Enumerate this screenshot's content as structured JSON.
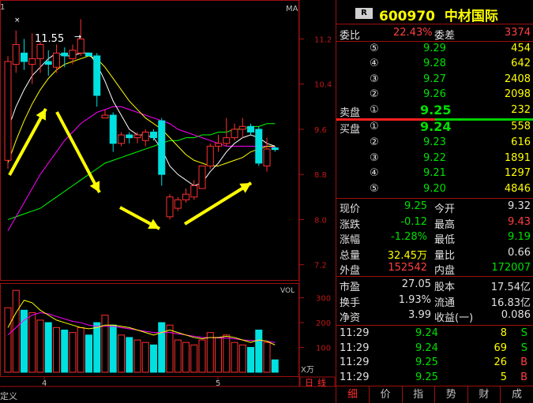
{
  "chart": {
    "top_left_label": "1",
    "ma_label": "MA",
    "high_annotation": "11.55",
    "price_axis": [
      "11.2",
      "10.4",
      "9.6",
      "8.8",
      "8.0",
      "7.2"
    ],
    "vol_label": "VOL",
    "vol_axis": [
      "300",
      "200",
      "100"
    ],
    "vol_unit": "X万",
    "x_ticks": [
      "4",
      "5"
    ],
    "tab_day": "日",
    "tab_line": "线",
    "bottom_left": "定义",
    "colors": {
      "up": "#ff3030",
      "down": "#00e0e0",
      "ma5": "#ffffff",
      "ma10": "#ffff00",
      "ma20": "#ff00ff",
      "ma60": "#00ff00",
      "arrow": "#ffff00",
      "grid": "#a01010"
    },
    "candles": [
      {
        "o": 9.05,
        "h": 10.9,
        "l": 8.9,
        "c": 10.8
      },
      {
        "o": 10.75,
        "h": 11.35,
        "l": 10.6,
        "c": 11.1
      },
      {
        "o": 10.95,
        "h": 11.2,
        "l": 10.65,
        "c": 10.8
      },
      {
        "o": 10.75,
        "h": 11.3,
        "l": 10.4,
        "c": 10.85
      },
      {
        "o": 10.85,
        "h": 11.15,
        "l": 10.6,
        "c": 11.1
      },
      {
        "o": 10.8,
        "h": 11.0,
        "l": 10.55,
        "c": 10.75
      },
      {
        "o": 10.7,
        "h": 11.1,
        "l": 10.6,
        "c": 10.95
      },
      {
        "o": 10.95,
        "h": 11.05,
        "l": 10.7,
        "c": 10.9
      },
      {
        "o": 10.85,
        "h": 11.1,
        "l": 10.75,
        "c": 11.0
      },
      {
        "o": 10.95,
        "h": 11.55,
        "l": 10.9,
        "c": 11.2
      },
      {
        "o": 10.95,
        "h": 10.95,
        "l": 10.9,
        "c": 10.9
      },
      {
        "o": 10.9,
        "h": 10.95,
        "l": 10.0,
        "c": 10.2
      },
      {
        "o": 9.8,
        "h": 9.95,
        "l": 9.8,
        "c": 9.85
      },
      {
        "o": 9.85,
        "h": 9.9,
        "l": 9.2,
        "c": 9.35
      },
      {
        "o": 9.35,
        "h": 9.55,
        "l": 9.3,
        "c": 9.5
      },
      {
        "o": 9.5,
        "h": 9.55,
        "l": 9.35,
        "c": 9.45
      },
      {
        "o": 9.45,
        "h": 9.55,
        "l": 9.35,
        "c": 9.5
      },
      {
        "o": 9.4,
        "h": 9.6,
        "l": 9.3,
        "c": 9.55
      },
      {
        "o": 9.55,
        "h": 9.6,
        "l": 9.4,
        "c": 9.45
      },
      {
        "o": 9.75,
        "h": 9.8,
        "l": 8.6,
        "c": 8.8
      },
      {
        "o": 8.05,
        "h": 8.45,
        "l": 8.0,
        "c": 8.4
      },
      {
        "o": 8.2,
        "h": 8.4,
        "l": 8.15,
        "c": 8.35
      },
      {
        "o": 8.35,
        "h": 8.55,
        "l": 8.3,
        "c": 8.45
      },
      {
        "o": 8.4,
        "h": 8.7,
        "l": 8.35,
        "c": 8.6
      },
      {
        "o": 8.55,
        "h": 8.95,
        "l": 8.55,
        "c": 8.95
      },
      {
        "o": 8.95,
        "h": 9.35,
        "l": 8.9,
        "c": 9.3
      },
      {
        "o": 9.3,
        "h": 9.5,
        "l": 9.2,
        "c": 9.35
      },
      {
        "o": 9.35,
        "h": 9.8,
        "l": 9.3,
        "c": 9.45
      },
      {
        "o": 9.45,
        "h": 9.7,
        "l": 9.4,
        "c": 9.6
      },
      {
        "o": 9.6,
        "h": 9.8,
        "l": 9.45,
        "c": 9.65
      },
      {
        "o": 9.65,
        "h": 9.7,
        "l": 9.5,
        "c": 9.55
      },
      {
        "o": 9.6,
        "h": 9.65,
        "l": 8.95,
        "c": 9.0
      },
      {
        "o": 8.95,
        "h": 9.45,
        "l": 8.85,
        "c": 9.25
      },
      {
        "o": 9.27,
        "h": 9.3,
        "l": 9.2,
        "c": 9.24
      }
    ],
    "ma5": [
      9.6,
      10.0,
      10.3,
      10.55,
      10.7,
      10.85,
      10.95,
      10.9,
      10.9,
      10.95,
      10.95,
      10.75,
      10.45,
      10.1,
      9.85,
      9.6,
      9.5,
      9.5,
      9.45,
      9.25,
      8.95,
      8.8,
      8.7,
      8.6,
      8.65,
      8.85,
      9.0,
      9.2,
      9.35,
      9.45,
      9.5,
      9.45,
      9.35,
      9.3
    ],
    "ma10": [
      9.0,
      9.4,
      9.75,
      10.05,
      10.3,
      10.5,
      10.65,
      10.75,
      10.8,
      10.85,
      10.9,
      10.85,
      10.7,
      10.5,
      10.3,
      10.1,
      9.95,
      9.8,
      9.7,
      9.6,
      9.45,
      9.3,
      9.15,
      9.05,
      9.0,
      8.95,
      8.95,
      9.0,
      9.05,
      9.1,
      9.2,
      9.25,
      9.3,
      9.3
    ],
    "ma20": [
      7.8,
      8.05,
      8.3,
      8.55,
      8.8,
      9.0,
      9.2,
      9.4,
      9.55,
      9.7,
      9.8,
      9.9,
      9.95,
      10.0,
      10.0,
      9.95,
      9.9,
      9.85,
      9.8,
      9.75,
      9.7,
      9.6,
      9.55,
      9.5,
      9.45,
      9.4,
      9.35,
      9.3,
      9.3,
      9.3,
      9.3,
      9.3,
      9.3,
      9.28
    ],
    "ma60": [
      8.0,
      8.05,
      8.1,
      8.15,
      8.2,
      8.3,
      8.4,
      8.5,
      8.6,
      8.7,
      8.8,
      8.9,
      9.0,
      9.05,
      9.1,
      9.15,
      9.2,
      9.25,
      9.3,
      9.35,
      9.4,
      9.4,
      9.45,
      9.45,
      9.5,
      9.5,
      9.55,
      9.55,
      9.6,
      9.6,
      9.65,
      9.65,
      9.7,
      9.7
    ],
    "volumes": [
      260,
      330,
      250,
      240,
      210,
      200,
      180,
      170,
      160,
      180,
      150,
      200,
      230,
      190,
      150,
      140,
      130,
      120,
      110,
      200,
      190,
      130,
      120,
      110,
      130,
      160,
      140,
      150,
      120,
      110,
      100,
      170,
      120,
      50
    ],
    "vol_ma1": [
      180,
      240,
      290,
      280,
      250,
      230,
      210,
      200,
      190,
      180,
      175,
      180,
      190,
      190,
      185,
      180,
      170,
      160,
      150,
      160,
      170,
      160,
      150,
      140,
      135,
      140,
      140,
      145,
      140,
      130,
      120,
      130,
      125,
      110
    ],
    "vol_ma2": [
      150,
      180,
      210,
      230,
      240,
      235,
      225,
      215,
      205,
      200,
      190,
      185,
      185,
      185,
      180,
      175,
      170,
      165,
      160,
      160,
      160,
      155,
      150,
      145,
      140,
      140,
      138,
      138,
      135,
      130,
      128,
      128,
      125,
      120
    ]
  },
  "panel": {
    "badge": "R",
    "code": "600970",
    "name": "中材国际",
    "weibi_label": "委比",
    "weibi_val": "22.43%",
    "weicha_label": "委差",
    "weicha_val": "3374",
    "sell_label": "卖盘",
    "buy_label": "买盘",
    "asks": [
      {
        "lvl": "⑤",
        "price": "9.29",
        "vol": "454"
      },
      {
        "lvl": "④",
        "price": "9.28",
        "vol": "642"
      },
      {
        "lvl": "③",
        "price": "9.27",
        "vol": "2408"
      },
      {
        "lvl": "②",
        "price": "9.26",
        "vol": "2098"
      },
      {
        "lvl": "①",
        "price": "9.25",
        "vol": "232"
      }
    ],
    "bids": [
      {
        "lvl": "①",
        "price": "9.24",
        "vol": "558"
      },
      {
        "lvl": "②",
        "price": "9.23",
        "vol": "616"
      },
      {
        "lvl": "③",
        "price": "9.22",
        "vol": "1891"
      },
      {
        "lvl": "④",
        "price": "9.21",
        "vol": "1297"
      },
      {
        "lvl": "⑤",
        "price": "9.20",
        "vol": "4846"
      }
    ],
    "quote": [
      {
        "l1": "现价",
        "v1": "9.25",
        "c1": "green",
        "l2": "今开",
        "v2": "9.32",
        "c2": "white"
      },
      {
        "l1": "涨跌",
        "v1": "-0.12",
        "c1": "green",
        "l2": "最高",
        "v2": "9.43",
        "c2": "red"
      },
      {
        "l1": "涨幅",
        "v1": "-1.28%",
        "c1": "green",
        "l2": "最低",
        "v2": "9.19",
        "c2": "green"
      },
      {
        "l1": "总量",
        "v1": "32.45万",
        "c1": "yellow",
        "l2": "量比",
        "v2": "0.66",
        "c2": "white"
      },
      {
        "l1": "外盘",
        "v1": "152542",
        "c1": "red",
        "l2": "内盘",
        "v2": "172007",
        "c2": "green"
      }
    ],
    "fund": [
      {
        "l1": "市盈",
        "v1": "27.05",
        "l2": "股本",
        "v2": "17.54亿"
      },
      {
        "l1": "换手",
        "v1": "1.93%",
        "l2": "流通",
        "v2": "16.83亿"
      },
      {
        "l1": "净资",
        "v1": "3.99",
        "l2": "收益(一)",
        "v2": "0.086"
      }
    ],
    "ticks": [
      {
        "time": "11:29",
        "price": "9.24",
        "vol": "8",
        "side": "S"
      },
      {
        "time": "11:29",
        "price": "9.24",
        "vol": "69",
        "side": "S"
      },
      {
        "time": "11:29",
        "price": "9.25",
        "vol": "26",
        "side": "B"
      },
      {
        "time": "11:29",
        "price": "9.25",
        "vol": "5",
        "side": "B"
      }
    ],
    "tabs": [
      "细",
      "价",
      "指",
      "势",
      "财",
      "成"
    ]
  }
}
